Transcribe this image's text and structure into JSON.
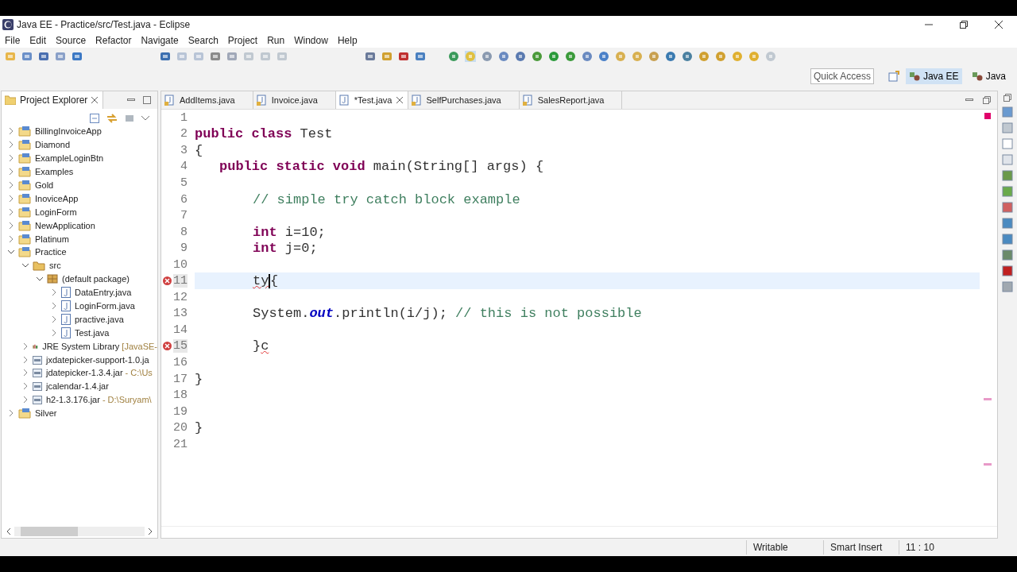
{
  "window": {
    "title": "Java EE - Practice/src/Test.java - Eclipse"
  },
  "menu": [
    "File",
    "Edit",
    "Source",
    "Refactor",
    "Navigate",
    "Search",
    "Project",
    "Run",
    "Window",
    "Help"
  ],
  "quick_access": {
    "placeholder": "Quick Access"
  },
  "perspectives": [
    {
      "label": "Java EE",
      "selected": true
    },
    {
      "label": "Java",
      "selected": false
    }
  ],
  "explorer": {
    "title": "Project Explorer",
    "tree": [
      {
        "label": "BillingInvoiceApp",
        "kind": "project",
        "expanded": false
      },
      {
        "label": "Diamond",
        "kind": "project",
        "expanded": false
      },
      {
        "label": "ExampleLoginBtn",
        "kind": "project",
        "expanded": false
      },
      {
        "label": "Examples",
        "kind": "project",
        "expanded": false
      },
      {
        "label": "Gold",
        "kind": "project",
        "expanded": false
      },
      {
        "label": "InoviceApp",
        "kind": "project",
        "expanded": false
      },
      {
        "label": "LoginForm",
        "kind": "project",
        "expanded": false
      },
      {
        "label": "NewApplication",
        "kind": "project",
        "expanded": false
      },
      {
        "label": "Platinum",
        "kind": "project",
        "expanded": false
      },
      {
        "label": "Practice",
        "kind": "project",
        "expanded": true,
        "children": [
          {
            "label": "src",
            "kind": "src",
            "expanded": true,
            "children": [
              {
                "label": "(default package)",
                "kind": "package",
                "expanded": true,
                "children": [
                  {
                    "label": "DataEntry.java",
                    "kind": "java",
                    "expanded": false
                  },
                  {
                    "label": "LoginForm.java",
                    "kind": "java",
                    "expanded": false
                  },
                  {
                    "label": "practive.java",
                    "kind": "java",
                    "expanded": false
                  },
                  {
                    "label": "Test.java",
                    "kind": "java",
                    "expanded": false
                  }
                ]
              }
            ]
          },
          {
            "label": "JRE System Library",
            "suffix": "[JavaSE-",
            "kind": "library",
            "expanded": false
          },
          {
            "label": "jxdatepicker-support-1.0.ja",
            "kind": "jar",
            "expanded": false
          },
          {
            "label": "jdatepicker-1.3.4.jar",
            "suffix": "- C:\\Us",
            "kind": "jar",
            "expanded": false
          },
          {
            "label": "jcalendar-1.4.jar",
            "kind": "jar",
            "expanded": false
          },
          {
            "label": "h2-1.3.176.jar",
            "suffix": "- D:\\Suryam\\",
            "kind": "jar",
            "expanded": false
          }
        ]
      },
      {
        "label": "Silver",
        "kind": "project",
        "expanded": false
      }
    ]
  },
  "editor_tabs": [
    {
      "label": "AddItems.java",
      "selected": false
    },
    {
      "label": "Invoice.java",
      "selected": false
    },
    {
      "label": "*Test.java",
      "selected": true
    },
    {
      "label": "SelfPurchases.java",
      "selected": false
    },
    {
      "label": "SalesReport.java",
      "selected": false
    }
  ],
  "code": [
    {
      "number": "1",
      "error": false,
      "current": false
    },
    {
      "number": "2",
      "error": false,
      "current": false,
      "kind": "none",
      "tokens": [
        {
          "kind": "keyword",
          "text": "public class"
        },
        {
          "kind": "plain",
          "text": " Test"
        }
      ]
    },
    {
      "number": "3",
      "error": false,
      "current": false,
      "kind": "none",
      "tokens": [
        {
          "kind": "plain",
          "text": "{"
        }
      ]
    },
    {
      "number": "4",
      "error": false,
      "current": false,
      "kind": "method",
      "tokens": [
        {
          "kind": "keyword",
          "text": "public static void"
        },
        {
          "kind": "plain",
          "text": " main(String[] args) {"
        }
      ]
    },
    {
      "number": "5",
      "error": false,
      "current": false
    },
    {
      "number": "6",
      "error": false,
      "current": false,
      "kind": "body",
      "tokens": [
        {
          "kind": "comment",
          "text": "// simple try catch block example"
        }
      ]
    },
    {
      "number": "7",
      "error": false,
      "current": false
    },
    {
      "number": "8",
      "error": false,
      "current": false,
      "kind": "body",
      "tokens": [
        {
          "kind": "keyword",
          "text": "int"
        },
        {
          "kind": "plain",
          "text": " i=10;"
        }
      ]
    },
    {
      "number": "9",
      "error": false,
      "current": false,
      "kind": "body",
      "tokens": [
        {
          "kind": "keyword",
          "text": "int"
        },
        {
          "kind": "plain",
          "text": " j=0;"
        }
      ]
    },
    {
      "number": "10",
      "error": false,
      "current": false
    },
    {
      "number": "11",
      "error": true,
      "current": true,
      "kind": "body",
      "tokens": [
        {
          "kind": "error",
          "text": "ty"
        },
        {
          "kind": "caret"
        },
        {
          "kind": "plain",
          "text": "{"
        }
      ]
    },
    {
      "number": "12",
      "error": false,
      "current": false
    },
    {
      "number": "13",
      "error": false,
      "current": false,
      "kind": "body",
      "tokens": [
        {
          "kind": "plain",
          "text": "System."
        },
        {
          "kind": "field",
          "text": "out"
        },
        {
          "kind": "plain",
          "text": ".println(i/j); "
        },
        {
          "kind": "comment",
          "text": "// this is not possible"
        }
      ]
    },
    {
      "number": "14",
      "error": false,
      "current": false
    },
    {
      "number": "15",
      "error": true,
      "current": false,
      "kind": "body",
      "tokens": [
        {
          "kind": "plain",
          "text": "}"
        },
        {
          "kind": "error",
          "text": "c"
        }
      ]
    },
    {
      "number": "16",
      "error": false,
      "current": false
    },
    {
      "number": "17",
      "error": false,
      "current": false,
      "kind": "none",
      "tokens": [
        {
          "kind": "plain",
          "text": "}"
        }
      ]
    },
    {
      "number": "18",
      "error": false,
      "current": false
    },
    {
      "number": "19",
      "error": false,
      "current": false
    },
    {
      "number": "20",
      "error": false,
      "current": false,
      "kind": "none",
      "tokens": [
        {
          "kind": "plain",
          "text": "}"
        }
      ]
    },
    {
      "number": "21",
      "error": false,
      "current": false
    }
  ],
  "status_bar": {
    "mode": "Writable",
    "insert": "Smart Insert",
    "position": "11 : 10"
  }
}
